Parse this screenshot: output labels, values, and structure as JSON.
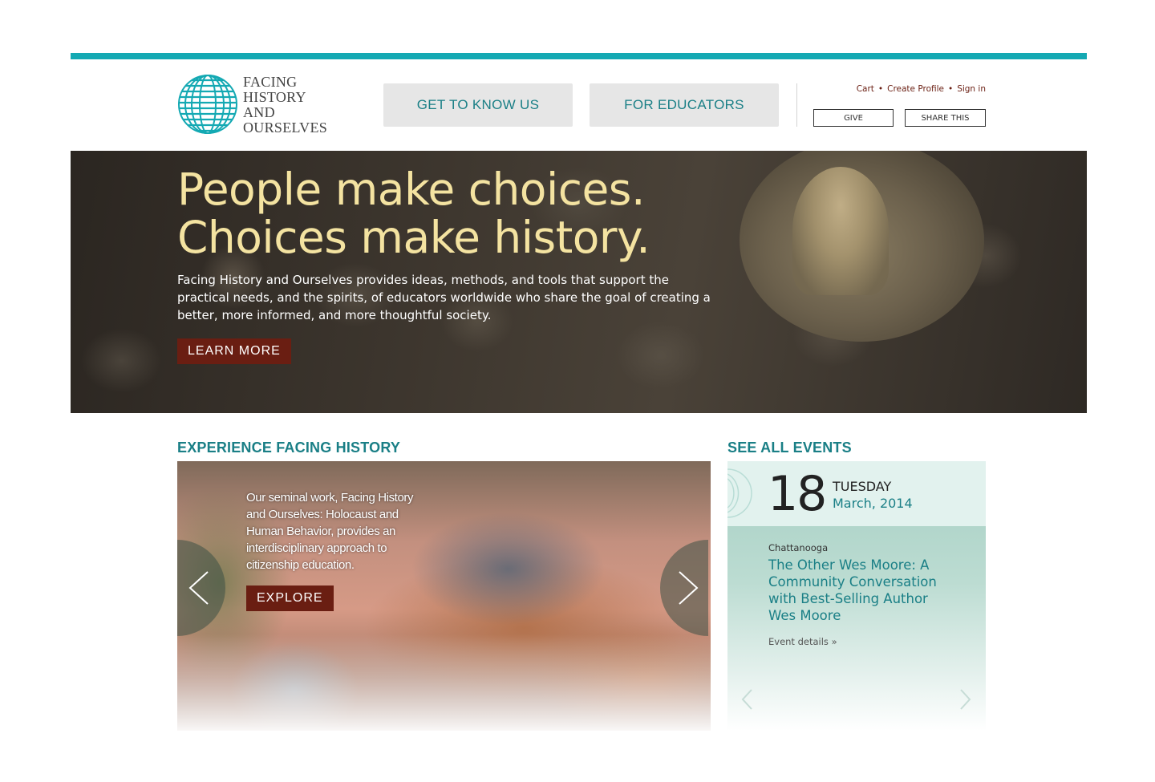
{
  "logo": {
    "lines": [
      "FACING",
      "HISTORY",
      "AND",
      "OURSELVES"
    ]
  },
  "nav": {
    "get_to_know_us": "GET TO KNOW US",
    "for_educators": "FOR EDUCATORS"
  },
  "utility": {
    "cart": "Cart",
    "create_profile": "Create Profile",
    "sign_in": "Sign in",
    "separator": "•",
    "give": "GIVE",
    "share_this": "SHARE THIS"
  },
  "hero": {
    "headline_line1": "People make choices.",
    "headline_line2": "Choices make history.",
    "body": "Facing History and Ourselves provides ideas, methods, and tools that support the practical needs, and the spirits, of educators worldwide who share the goal of creating a better, more informed, and more thoughtful society.",
    "cta": "LEARN MORE"
  },
  "experience": {
    "title": "EXPERIENCE FACING HISTORY",
    "text": "Our seminal work, Facing History and Ourselves: Holocaust and Human Behavior, provides an interdisciplinary approach to citizenship education.",
    "cta": "EXPLORE"
  },
  "events": {
    "title": "SEE ALL EVENTS",
    "day": "18",
    "weekday": "TUESDAY",
    "month_year": "March, 2014",
    "city": "Chattanooga",
    "event_title": "The Other Wes Moore: A Community Conversation with Best-Selling Author Wes Moore",
    "details_link": "Event details »"
  },
  "colors": {
    "accent_teal": "#14a9b3",
    "heading_teal": "#1a7f86",
    "brand_maroon": "#6a1e12",
    "headline_yellow": "#f4e3a1"
  }
}
